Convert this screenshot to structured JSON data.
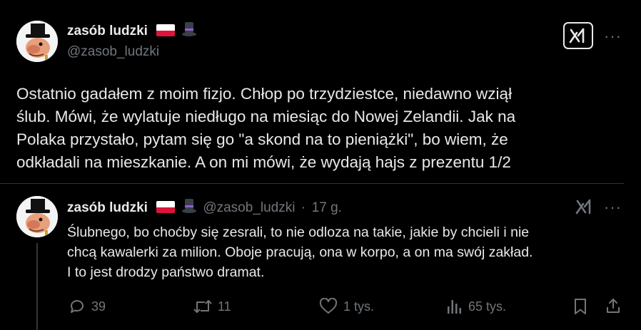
{
  "main_tweet": {
    "display_name": "zasób ludzki",
    "handle": "@zasob_ludzki",
    "text_lines": [
      "Ostatnio gadałem z moim fizjo. Chłop po trzydziestce, niedawno wziął",
      "ślub. Mówi, że wylatuje niedługo na miesiąc do Nowej Zelandii. Jak na",
      "Polaka przystało, pytam się go \"a skond na to pieniążki\", bo wiem, że",
      "odkładali na mieszkanie. A on mi mówi, że wydają hajs z prezentu 1/2"
    ]
  },
  "reply_tweet": {
    "display_name": "zasób ludzki",
    "handle": "@zasob_ludzki",
    "separator": "·",
    "time": "17 g.",
    "text_lines": [
      "Ślubnego, bo choćby się zesrali, to nie odloza na takie, jakie by chcieli i nie",
      "chcą kawalerki za milion. Oboje pracują, ona w korpo, a on ma swój zakład.",
      "I to jest drodzy państwo dramat."
    ],
    "actions": {
      "replies": "39",
      "retweets": "11",
      "likes": "1 tys.",
      "views": "65 tys."
    }
  },
  "more_label": "···",
  "colors": {
    "background": "#000000",
    "text": "#e7e9ea",
    "secondary": "#71767b",
    "divider": "#2f3336"
  },
  "icons": [
    "grok-icon",
    "more-icon",
    "reply-icon",
    "retweet-icon",
    "like-icon",
    "views-icon",
    "bookmark-icon",
    "share-icon"
  ]
}
